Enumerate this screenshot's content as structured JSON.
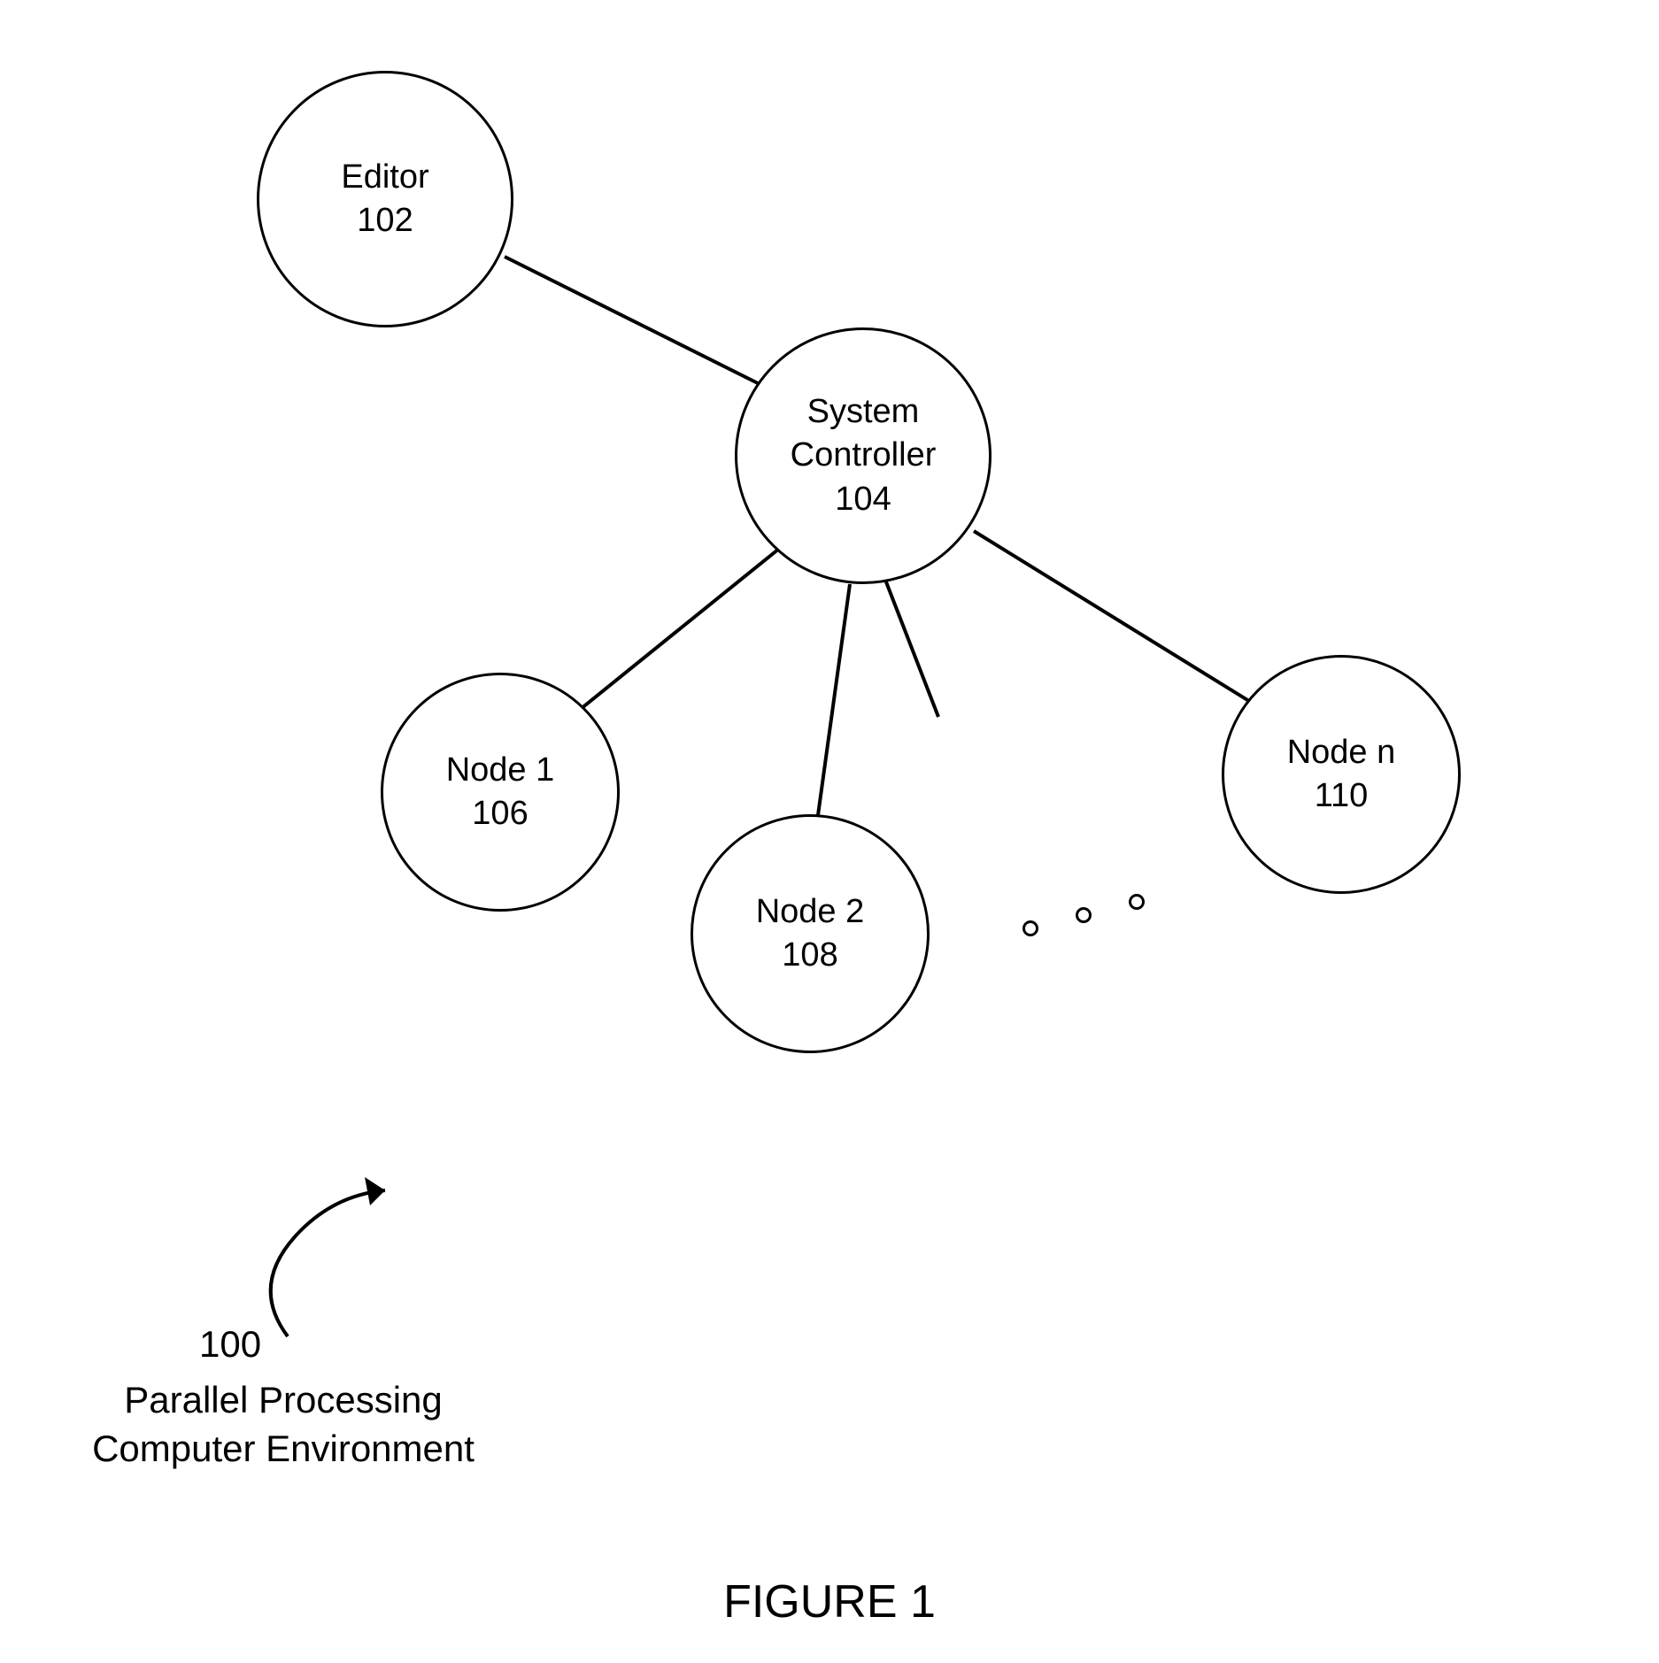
{
  "nodes": {
    "editor": {
      "label": "Editor",
      "number": "102"
    },
    "controller": {
      "label": "System\nController",
      "number": "104"
    },
    "node1": {
      "label": "Node 1",
      "number": "106"
    },
    "node2": {
      "label": "Node 2",
      "number": "108"
    },
    "noden": {
      "label": "Node n",
      "number": "110"
    }
  },
  "caption": {
    "number": "100",
    "line1": "Parallel Processing",
    "line2": "Computer Environment"
  },
  "figure_label": "FIGURE 1"
}
